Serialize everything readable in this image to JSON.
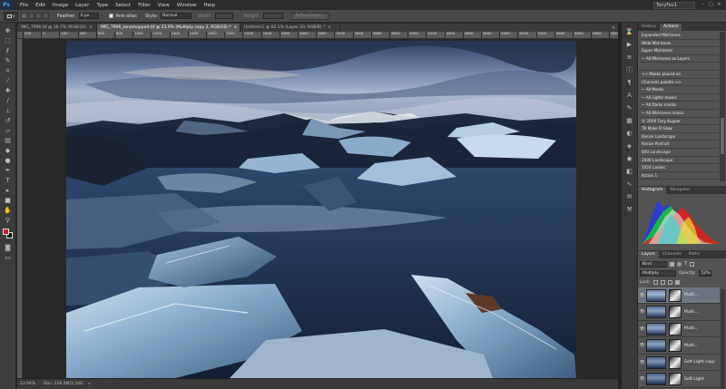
{
  "app": {
    "logo": "Ps"
  },
  "menu": [
    "File",
    "Edit",
    "Image",
    "Layer",
    "Type",
    "Select",
    "Filter",
    "View",
    "Window",
    "Help"
  ],
  "workspace": "TonyFav1",
  "window_controls": [
    "–",
    "□",
    "✕"
  ],
  "options": {
    "feather_label": "Feather:",
    "feather_value": "0 px",
    "anti_alias_label": "Anti-alias",
    "style_label": "Style:",
    "style_value": "Normal",
    "width_label": "Width:",
    "height_label": "Height:",
    "refine_edge_label": "Refine Edge..."
  },
  "tabs": [
    {
      "label": "IMG_7906.tif @ 16.7% (RGB/16)",
      "close": "×"
    },
    {
      "label": "IMG_7906_tonemapped.tif @ 23.9% (Multiply copy 3, RGB/16) *",
      "close": "×"
    },
    {
      "label": "Untitled-1 @ 62.1% (Layer 20, RGB/8) *",
      "close": "×"
    }
  ],
  "tab_overflow": "»",
  "ruler_ticks": [
    "200",
    "0",
    "200",
    "400",
    "600",
    "800",
    "1000",
    "1200",
    "1400",
    "1600",
    "1800",
    "2000",
    "2200",
    "2400",
    "2600",
    "2800",
    "3000",
    "3200",
    "3400",
    "3600",
    "3800",
    "4000",
    "4200",
    "4400",
    "4600",
    "4800",
    "5000",
    "5200",
    "5400",
    "5600",
    "5800",
    "6000",
    "6200"
  ],
  "status": {
    "zoom": "23.94%",
    "doc": "Doc: 129.3M/3.54G",
    "arrow": "▸"
  },
  "tools": [
    {
      "name": "move-tool-icon",
      "glyph": "✥"
    },
    {
      "name": "marquee-tool-icon",
      "glyph": "⬚"
    },
    {
      "name": "lasso-tool-icon",
      "glyph": "ℓ"
    },
    {
      "name": "quick-select-tool-icon",
      "glyph": "✎"
    },
    {
      "name": "crop-tool-icon",
      "glyph": "⌗"
    },
    {
      "name": "eyedropper-tool-icon",
      "glyph": "⁄"
    },
    {
      "name": "healing-brush-tool-icon",
      "glyph": "✚"
    },
    {
      "name": "brush-tool-icon",
      "glyph": "∕"
    },
    {
      "name": "clone-stamp-tool-icon",
      "glyph": "⊥"
    },
    {
      "name": "history-brush-tool-icon",
      "glyph": "↺"
    },
    {
      "name": "eraser-tool-icon",
      "glyph": "▱"
    },
    {
      "name": "gradient-tool-icon",
      "glyph": "▤"
    },
    {
      "name": "blur-tool-icon",
      "glyph": "◆"
    },
    {
      "name": "dodge-tool-icon",
      "glyph": "●"
    },
    {
      "name": "pen-tool-icon",
      "glyph": "✒"
    },
    {
      "name": "type-tool-icon",
      "glyph": "T"
    },
    {
      "name": "path-select-tool-icon",
      "glyph": "▸"
    },
    {
      "name": "shape-tool-icon",
      "glyph": "■"
    },
    {
      "name": "hand-tool-icon",
      "glyph": "✋"
    },
    {
      "name": "zoom-tool-icon",
      "glyph": "⚲"
    }
  ],
  "tools_bottom": [
    {
      "name": "quick-mask-icon",
      "glyph": "◙"
    },
    {
      "name": "screen-mode-icon",
      "glyph": "▭"
    }
  ],
  "colors": {
    "foreground": "#c21f2a",
    "background": "#111111"
  },
  "dock_icons": [
    {
      "name": "history-icon",
      "glyph": "⌛"
    },
    {
      "name": "actions-icon",
      "glyph": "▶"
    },
    {
      "name": "properties-icon",
      "glyph": "≡"
    },
    {
      "name": "info-icon",
      "glyph": "ⓘ"
    },
    {
      "name": "paragraph-icon",
      "glyph": "¶"
    },
    {
      "name": "character-icon",
      "glyph": "A"
    },
    {
      "name": "brush-presets-icon",
      "glyph": "✎"
    },
    {
      "name": "swatches-icon",
      "glyph": "▦"
    },
    {
      "name": "adjustments-icon",
      "glyph": "◐"
    },
    {
      "name": "styles-icon",
      "glyph": "◈"
    },
    {
      "name": "color-icon",
      "glyph": "◉"
    },
    {
      "name": "channels-icon",
      "glyph": "◧"
    },
    {
      "name": "paths-icon",
      "glyph": "∿"
    },
    {
      "name": "notes-icon",
      "glyph": "✉"
    },
    {
      "name": "tool-presets-icon",
      "glyph": "⚒"
    }
  ],
  "actions_panel": {
    "tabs": [
      "History",
      "Actions"
    ],
    "items": [
      "Expanded Mid-tones",
      "Wide Mid-tones",
      "Super Mid-tones",
      "~ All Mid-tones as Layers",
      "",
      "<< Masks placed on",
      "Channels palette >>",
      "~ All Masks",
      "~ All Lights masks",
      "~ All Darks masks",
      "~ All Mid-tones masks",
      "© 2009 Tony Kuyper",
      "TK Make B Glow",
      "Resize Landscape",
      "Resize Portrait",
      "800 Landscape",
      "2000 Landscape",
      "1024 Landsc",
      "Action 1"
    ]
  },
  "histogram_panel": {
    "tabs": [
      "Histogram",
      "Navigator"
    ]
  },
  "layers_panel": {
    "tabs": [
      "Layers",
      "Channels",
      "Paths"
    ],
    "kind_label": "Kind",
    "blend_mode": "Multiply",
    "opacity_label": "Opacity:",
    "opacity_value": "52%",
    "lock_label": "Lock:",
    "eye": "👁",
    "layers": [
      {
        "name": "Multi...",
        "selected": true
      },
      {
        "name": "Multi...",
        "selected": false
      },
      {
        "name": "Multi...",
        "selected": false
      },
      {
        "name": "Multi...",
        "selected": false
      },
      {
        "name": "Soft Light copy",
        "selected": false
      },
      {
        "name": "Soft Light",
        "selected": false
      },
      {
        "name": "Screen",
        "selected": false
      }
    ]
  }
}
